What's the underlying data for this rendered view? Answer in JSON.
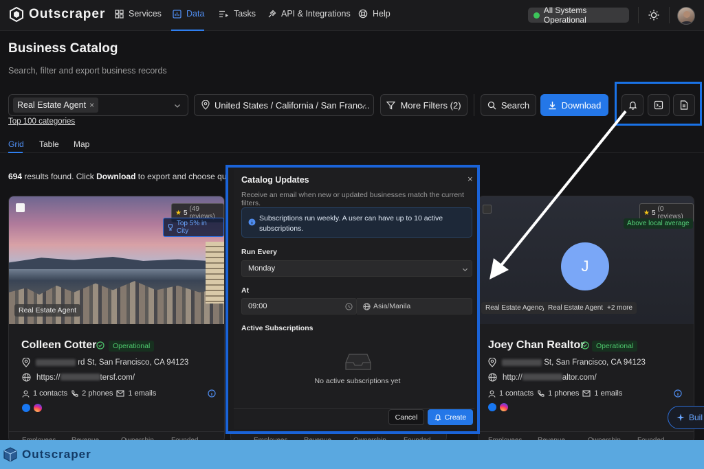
{
  "app": {
    "name": "Outscraper",
    "status": "All Systems Operational"
  },
  "nav": {
    "items": [
      {
        "label": "Services",
        "icon": "grid-icon"
      },
      {
        "label": "Data",
        "icon": "chart-icon"
      },
      {
        "label": "Tasks",
        "icon": "list-play-icon"
      },
      {
        "label": "API & Integrations",
        "icon": "plug-icon"
      },
      {
        "label": "Help",
        "icon": "lifebuoy-icon"
      }
    ],
    "active": "Data"
  },
  "page": {
    "title": "Business Catalog",
    "subtitle": "Search, filter and export business records"
  },
  "filters": {
    "category_chip": "Real Estate Agent",
    "location": "United States / California / San Franc...",
    "more_filters": "More Filters (2)",
    "top_categories_link": "Top 100 categories"
  },
  "actions": {
    "search": "Search",
    "download": "Download"
  },
  "tabs": [
    "Grid",
    "Table",
    "Map"
  ],
  "active_tab": "Grid",
  "results": {
    "count": "694",
    "text_before": " results found. Click ",
    "bold": "Download",
    "text_after": " to export and choose quantity."
  },
  "cards": [
    {
      "name": "Colleen Cotter",
      "status": "Operational",
      "address_suffix": "rd St, San Francisco, CA 94123",
      "website_prefix": "https://",
      "website_suffix": "tersf.com/",
      "contacts": "1 contacts",
      "phones": "2 phones",
      "emails": "1 emails",
      "rating": "5",
      "reviews": "(49 reviews)",
      "badge": "Top 5% in City",
      "category": "Real Estate Agent"
    },
    {
      "name": "Joey Chan Realtor",
      "status": "Operational",
      "initial": "J",
      "address_suffix": "St, San Francisco, CA 94123",
      "website_prefix": "http://",
      "website_suffix": "altor.com/",
      "contacts": "1 contacts",
      "phones": "1 phones",
      "emails": "1 emails",
      "rating": "5",
      "reviews": "(0 reviews)",
      "badge": "Above local average",
      "tags": [
        "Real Estate Agency",
        "Real Estate Agent",
        "+2 more"
      ]
    }
  ],
  "card_footer": [
    "Employees",
    "Revenue",
    "Ownership",
    "Founded"
  ],
  "modal": {
    "title": "Catalog Updates",
    "subtitle": "Receive an email when new or updated businesses match the current filters.",
    "info": "Subscriptions run weekly. A user can have up to 10 active subscriptions.",
    "run_every_label": "Run Every",
    "run_every_value": "Monday",
    "at_label": "At",
    "time_value": "09:00",
    "timezone": "Asia/Manila",
    "active_label": "Active Subscriptions",
    "empty_text": "No active subscriptions yet",
    "cancel": "Cancel",
    "create": "Create"
  },
  "float_button": "Buil",
  "banner": {
    "text": "Outscraper"
  },
  "colors": {
    "accent": "#2477e8",
    "highlight": "#1a72e6",
    "status_green": "#3cc45a"
  }
}
